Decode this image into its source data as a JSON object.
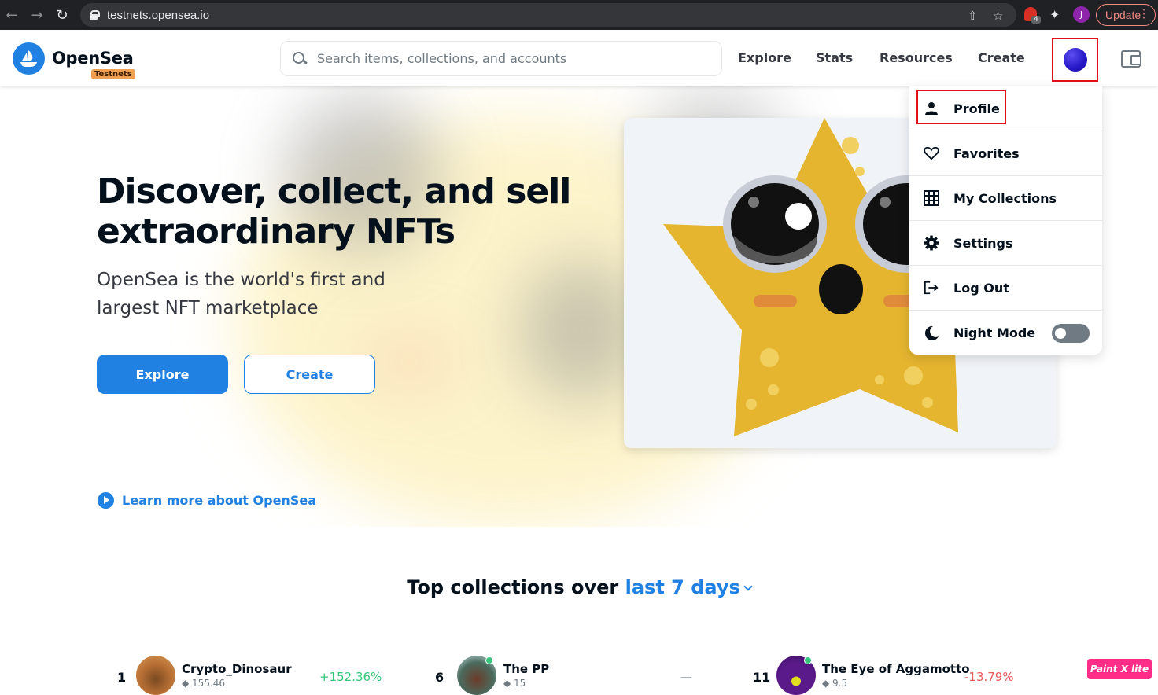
{
  "browser": {
    "url": "testnets.opensea.io",
    "update_label": "Update",
    "profile_initial": "J",
    "extension_badge": "4"
  },
  "header": {
    "logo_text": "OpenSea",
    "logo_badge": "Testnets",
    "search_placeholder": "Search items, collections, and accounts",
    "nav": [
      "Explore",
      "Stats",
      "Resources",
      "Create"
    ]
  },
  "hero": {
    "title": "Discover, collect, and sell extraordinary NFTs",
    "subtitle": "OpenSea is the world's first and largest NFT marketplace",
    "explore_label": "Explore",
    "create_label": "Create",
    "learn_more": "Learn more about OpenSea"
  },
  "dropdown": {
    "items": [
      {
        "label": "Profile",
        "icon": "person-icon"
      },
      {
        "label": "Favorites",
        "icon": "heart-icon"
      },
      {
        "label": "My Collections",
        "icon": "grid-icon"
      },
      {
        "label": "Settings",
        "icon": "gear-icon"
      },
      {
        "label": "Log Out",
        "icon": "logout-icon"
      },
      {
        "label": "Night Mode",
        "icon": "moon-icon"
      }
    ],
    "night_mode_on": false
  },
  "top_collections": {
    "heading_prefix": "Top collections over",
    "period": "last 7 days",
    "rows": [
      {
        "rank": "1",
        "name": "Crypto_Dinosaur",
        "volume": "◆ 155.46",
        "change": "+152.36%",
        "change_color": "#34c77b"
      },
      {
        "rank": "6",
        "name": "The PP",
        "volume": "◆ 15",
        "change": "—",
        "change_color": "#707a83"
      },
      {
        "rank": "11",
        "name": "The Eye of Aggamotto",
        "volume": "◆ 9.5",
        "change": "-13.79%",
        "change_color": "#eb5757"
      }
    ]
  },
  "overlay_badge": "Paint X lite",
  "colors": {
    "brand": "#2081e2",
    "highlight": "#e3101b"
  }
}
